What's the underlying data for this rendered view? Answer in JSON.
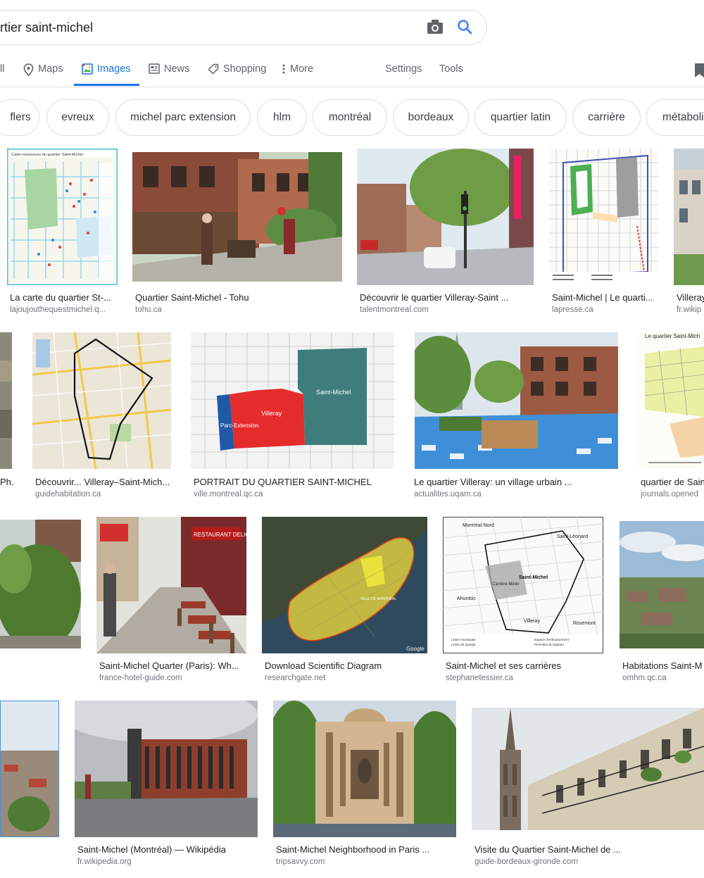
{
  "search": {
    "query": "rtier saint-michel"
  },
  "tabs": [
    {
      "label": "ll"
    },
    {
      "label": "Maps"
    },
    {
      "label": "Images"
    },
    {
      "label": "News"
    },
    {
      "label": "Shopping"
    },
    {
      "label": "More"
    },
    {
      "label": "Settings"
    },
    {
      "label": "Tools"
    }
  ],
  "chips": [
    "flers",
    "evreux",
    "michel parc extension",
    "hlm",
    "montréal",
    "bordeaux",
    "quartier latin",
    "carrière",
    "métaboli"
  ],
  "results": [
    {
      "title": "La carte du quartier St-...",
      "source": "lajoujouthequestmichel.q..."
    },
    {
      "title": "Quartier Saint-Michel - Tohu",
      "source": "tohu.ca"
    },
    {
      "title": "Découvrir le quartier Villeray-Saint ...",
      "source": "talentmontreal.com"
    },
    {
      "title": "Saint-Michel | Le quarti...",
      "source": "lapresse.ca"
    },
    {
      "title": "Villeray",
      "source": "fr.wikip"
    },
    {
      "title": "Ph...",
      "source": ""
    },
    {
      "title": "Découvrir... Villeray–Saint-Mich...",
      "source": "guidehabitation.ca"
    },
    {
      "title": "PORTRAIT DU QUARTIER SAINT-MICHEL",
      "source": "ville.montreal.qc.ca"
    },
    {
      "title": "Le quartier Villeray: un village urbain ...",
      "source": "actualites.uqam.ca"
    },
    {
      "title": "quartier de Sain",
      "source": "journals.opened"
    },
    {
      "title": "Saint-Michel Quarter (Paris): Wh...",
      "source": "france-hotel-guide.com"
    },
    {
      "title": "Download Scientific Diagram",
      "source": "researchgate.net"
    },
    {
      "title": "Saint-Michel et ses carrières",
      "source": "stephanetessier.ca"
    },
    {
      "title": "Habitations Saint-M",
      "source": "omhm.qc.ca"
    },
    {
      "title": "Saint-Michel (Montréal) — Wikipédia",
      "source": "fr.wikipedia.org"
    },
    {
      "title": "Saint-Michel Neighborhood in Paris ...",
      "source": "tripsavvy.com"
    },
    {
      "title": "Visite du Quartier Saint-Michel de ...",
      "source": "guide-bordeaux-gironde.com"
    }
  ],
  "image_text": {
    "map1_header": "Carte-ressources du quartier Saint-Michel",
    "parc_extension": "Parc-Extension",
    "villeray": "Villeray",
    "saint_michel": "Saint-Michel",
    "journal_header": "Le quartier Saint-Mich",
    "rd_city": "VILLE DE MONTRÉAL",
    "rd_google": "Google",
    "sm_nord": "Montréal-Nord",
    "sm_leonard": "Saint-Léonard",
    "sm_label": "Saint-Michel",
    "sm_ahuntsic": "Ahuntsic",
    "sm_villeray": "Villeray",
    "sm_rosemont": "Rosemont",
    "sm_miron": "Carrière Miron",
    "sm_legend1": "Limite municipale",
    "sm_legend2": "Limite de quartier",
    "sm_legend3": "Espace d'enfouissement",
    "sm_legend4": "Périmètre du plateau",
    "paris_sign": "RESTAURANT DELICE"
  }
}
